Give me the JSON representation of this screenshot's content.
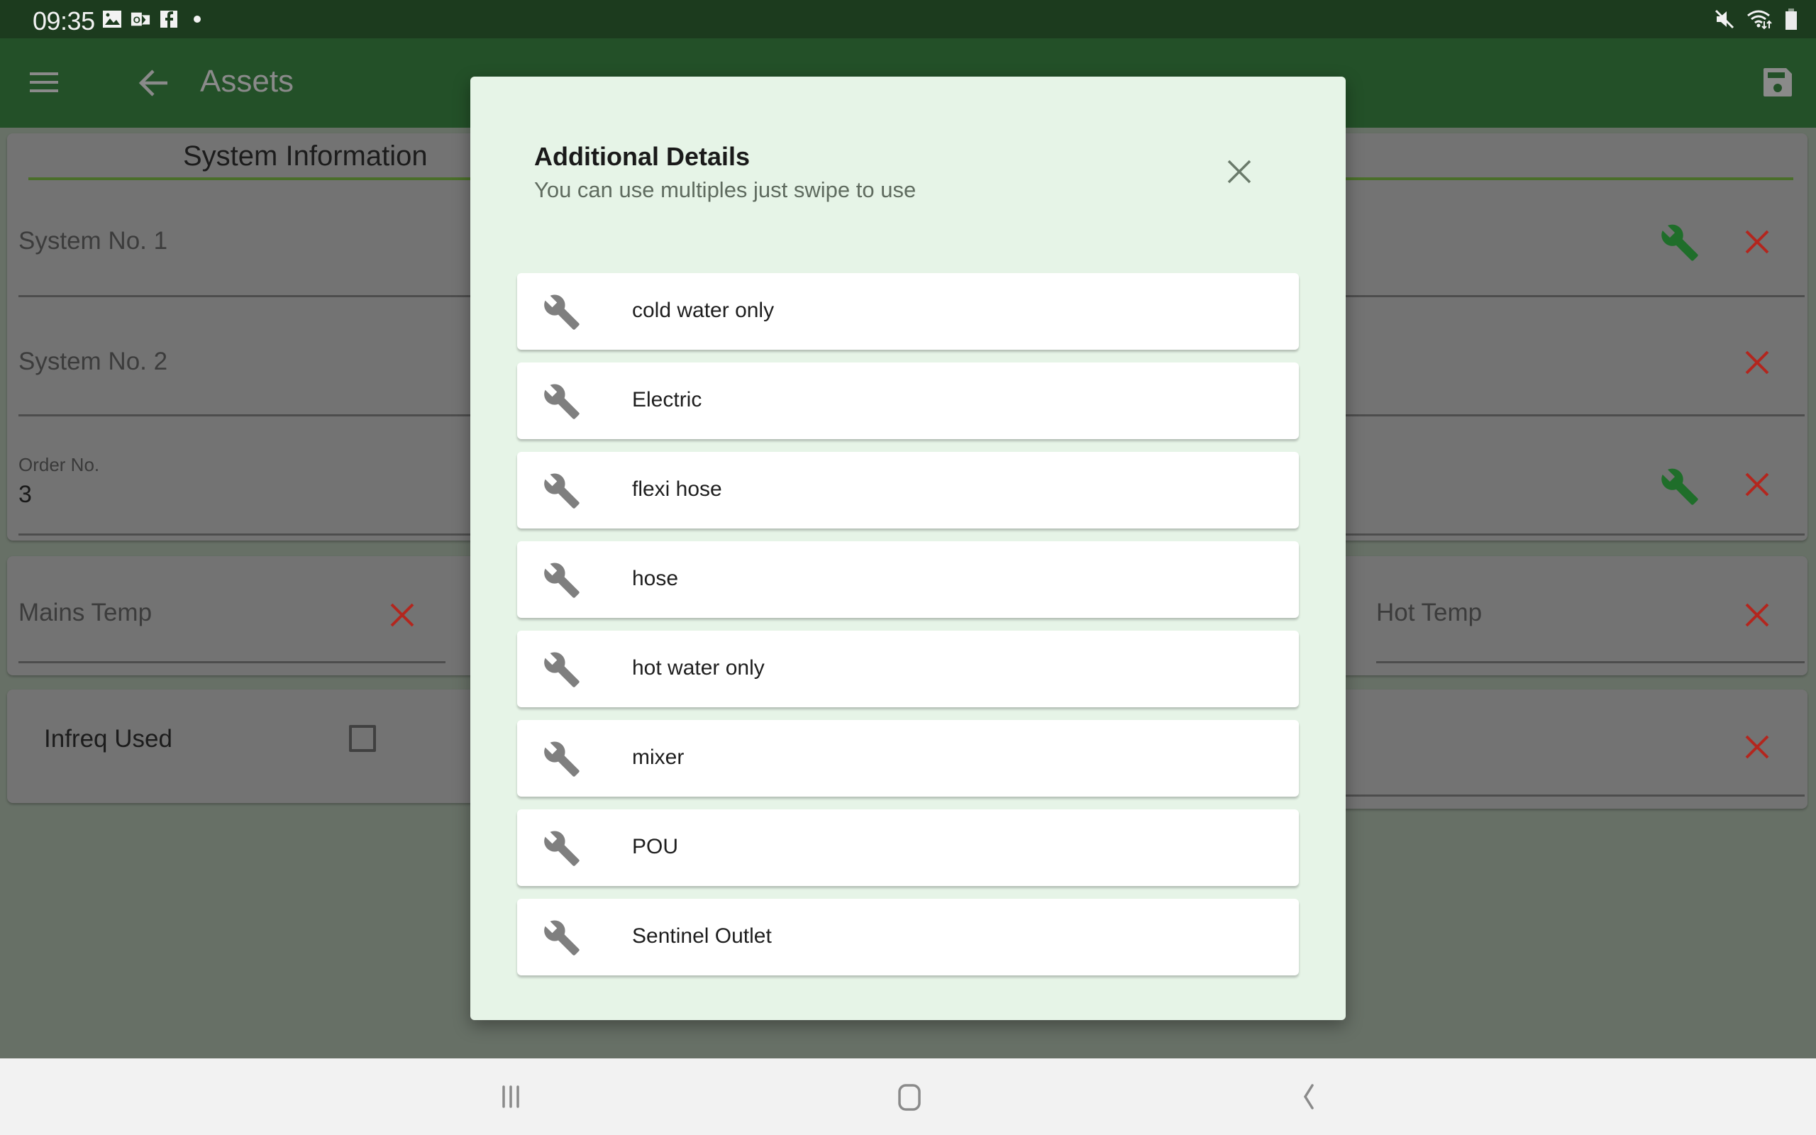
{
  "status_bar": {
    "time": "09:35",
    "left_icons": [
      "gallery-icon",
      "outlook-icon",
      "facebook-icon",
      "notification-dot-icon"
    ],
    "right_icons": [
      "mute-icon",
      "wifi-icon",
      "battery-icon"
    ]
  },
  "app_bar": {
    "title": "Assets",
    "menu_icon": "hamburger-menu-icon",
    "back_icon": "arrow-back-icon",
    "save_icon": "floppy-save-icon",
    "color": "#235028"
  },
  "background_form": {
    "section_title": "System Information",
    "fields": [
      {
        "label": "System No. 1",
        "value": "",
        "has_wrench": true
      },
      {
        "label": "System No. 2",
        "value": "",
        "has_wrench": false
      },
      {
        "label": "Order No.",
        "value": "3",
        "has_wrench": true
      }
    ],
    "mains_temp": {
      "label": "Mains Temp",
      "value": ""
    },
    "hot_temp": {
      "label": "Hot Temp",
      "value": ""
    },
    "infreq_used": {
      "label": "Infreq Used",
      "checked": false
    },
    "accent_wrench_color": "#1f6e2a",
    "clear_color": "#b3261e"
  },
  "modal": {
    "title": "Additional Details",
    "subtitle": "You can use multiples just swipe to use",
    "close_icon": "close-icon",
    "options": [
      {
        "label": "cold water only",
        "icon": "wrench-icon"
      },
      {
        "label": "Electric",
        "icon": "wrench-icon"
      },
      {
        "label": "flexi hose",
        "icon": "wrench-icon"
      },
      {
        "label": "hose",
        "icon": "wrench-icon"
      },
      {
        "label": "hot water only",
        "icon": "wrench-icon"
      },
      {
        "label": "mixer",
        "icon": "wrench-icon"
      },
      {
        "label": "POU",
        "icon": "wrench-icon"
      },
      {
        "label": "Sentinel Outlet",
        "icon": "wrench-icon"
      }
    ],
    "background": "#e6f4e7"
  },
  "nav_bar": {
    "buttons": [
      "recent-apps-icon",
      "home-icon",
      "back-chevron-icon"
    ]
  }
}
